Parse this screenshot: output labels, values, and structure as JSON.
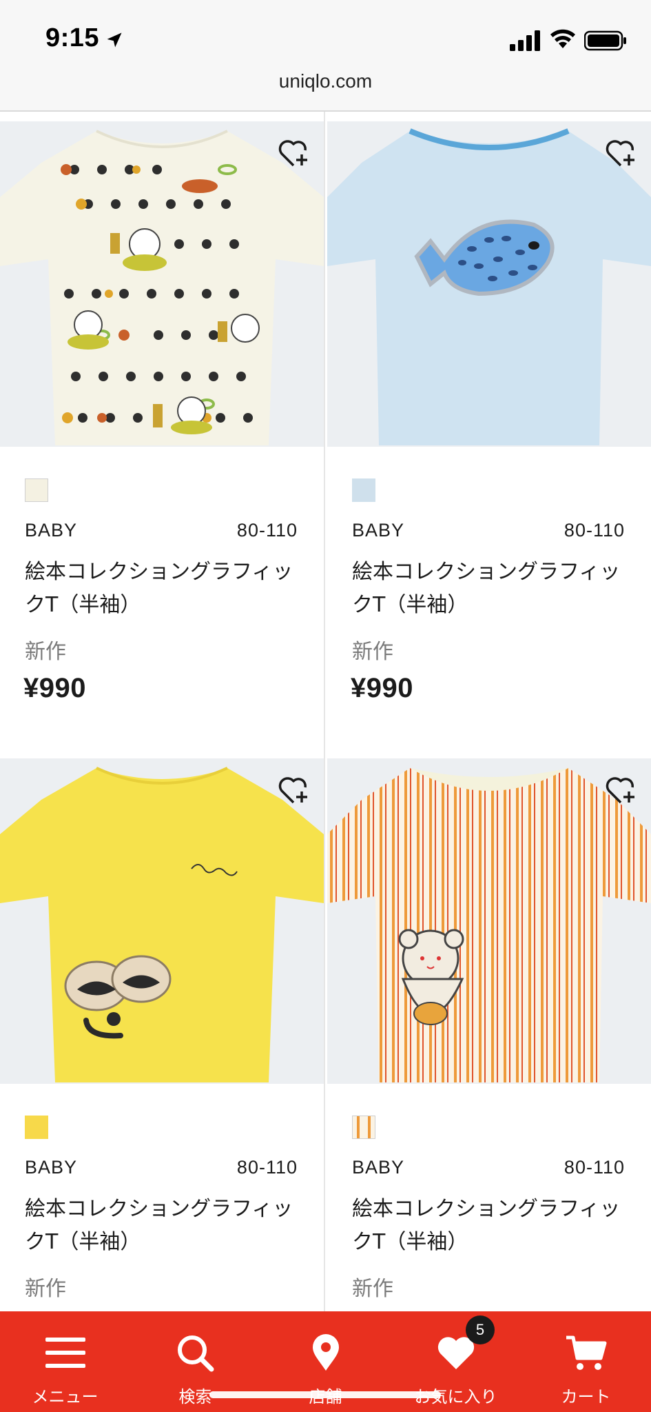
{
  "status_bar": {
    "time": "9:15"
  },
  "browser": {
    "url": "uniqlo.com"
  },
  "products": [
    {
      "category": "BABY",
      "size": "80-110",
      "name": "絵本コレクショングラフィックT（半袖）",
      "tag": "新作",
      "price": "¥990",
      "swatch_color": "#f4f1e2",
      "image": "cream-tshirt-pans-bear-print"
    },
    {
      "category": "BABY",
      "size": "80-110",
      "name": "絵本コレクショングラフィックT（半袖）",
      "tag": "新作",
      "price": "¥990",
      "swatch_color": "#cfe0ec",
      "image": "light-blue-tshirt-fish-print"
    },
    {
      "category": "BABY",
      "size": "80-110",
      "name": "絵本コレクショングラフィックT（半袖）",
      "tag": "新作",
      "swatch_color": "#f7d94a",
      "image": "yellow-tshirt-face-print"
    },
    {
      "category": "BABY",
      "size": "80-110",
      "name": "絵本コレクショングラフィックT（半袖）",
      "tag": "新作",
      "swatch_color": "#f2c98c",
      "image": "orange-stripe-tshirt-bear-print"
    }
  ],
  "bottom_nav": {
    "items": [
      {
        "label": "メニュー",
        "icon": "menu-icon"
      },
      {
        "label": "検索",
        "icon": "search-icon"
      },
      {
        "label": "店舗",
        "icon": "location-pin-icon"
      },
      {
        "label": "お気に入り",
        "icon": "heart-icon"
      },
      {
        "label": "カート",
        "icon": "cart-icon"
      }
    ],
    "favorites_count": "5"
  },
  "colors": {
    "brand_red": "#e8301f",
    "tile_bg": "#eceff2"
  }
}
